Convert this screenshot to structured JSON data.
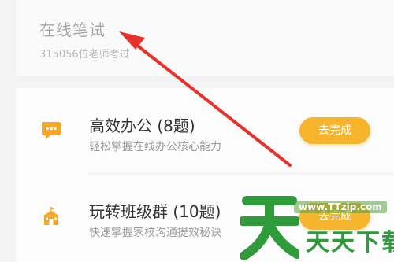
{
  "header": {
    "title": "在线笔试",
    "subtitle": "315056位老师考过"
  },
  "items": [
    {
      "title": "高效办公 (8题)",
      "desc": "轻松掌握在线办公核心能力",
      "button": "去完成",
      "icon": "chat-bubble-icon"
    },
    {
      "title": "玩转班级群 (10题)",
      "desc": "快速掌握家校沟通提效秘诀",
      "button": "去完成",
      "icon": "school-icon"
    }
  ],
  "watermark": {
    "url": "www.TTzip.com",
    "text": "天天下载"
  },
  "colors": {
    "accent": "#f6b52c",
    "arrow": "#e8312b",
    "watermark": "#2f9b3b"
  }
}
